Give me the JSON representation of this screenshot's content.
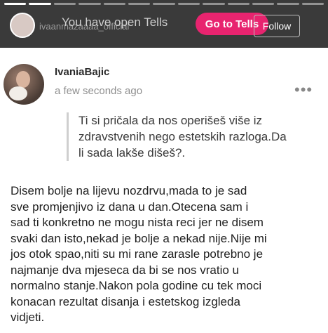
{
  "story_header": {
    "username": "ivaanmazaaaa_official",
    "banner_text": "You have open Tells",
    "tells_button_label": "Go to Tells",
    "follow_button_label": "Follow"
  },
  "post": {
    "author": "IvaniaBajic",
    "timestamp": "a few seconds ago",
    "more_icon": "more-icon",
    "question_lines": [
      "Ti si pričala da nos operišeš više iz",
      "zdravstvenih nego estetskih razloga.Da",
      "li sada lakše dišeš?."
    ],
    "answer_lines": [
      "Disem bolje na lijevu nozdrvu,mada to je sad",
      "sve promjenjivo iz dana u dan.Otecena sam i",
      "sad ti konkretno ne mogu nista reci jer ne disem",
      "svaki dan isto,nekad je bolje a nekad nije.Nije mi",
      "jos otok spao,niti su mi rane zarasle potrebno je",
      "najmanje dva mjeseca da bi se nos vratio u",
      "normalno stanje.Nakon pola godine cu tek moci",
      "konacan rezultat disanja i estetskog izgleda",
      "vidjeti."
    ]
  },
  "colors": {
    "accent": "#e8246f",
    "header_bg": "#3a3a3a",
    "card_bg": "#ffffff"
  }
}
